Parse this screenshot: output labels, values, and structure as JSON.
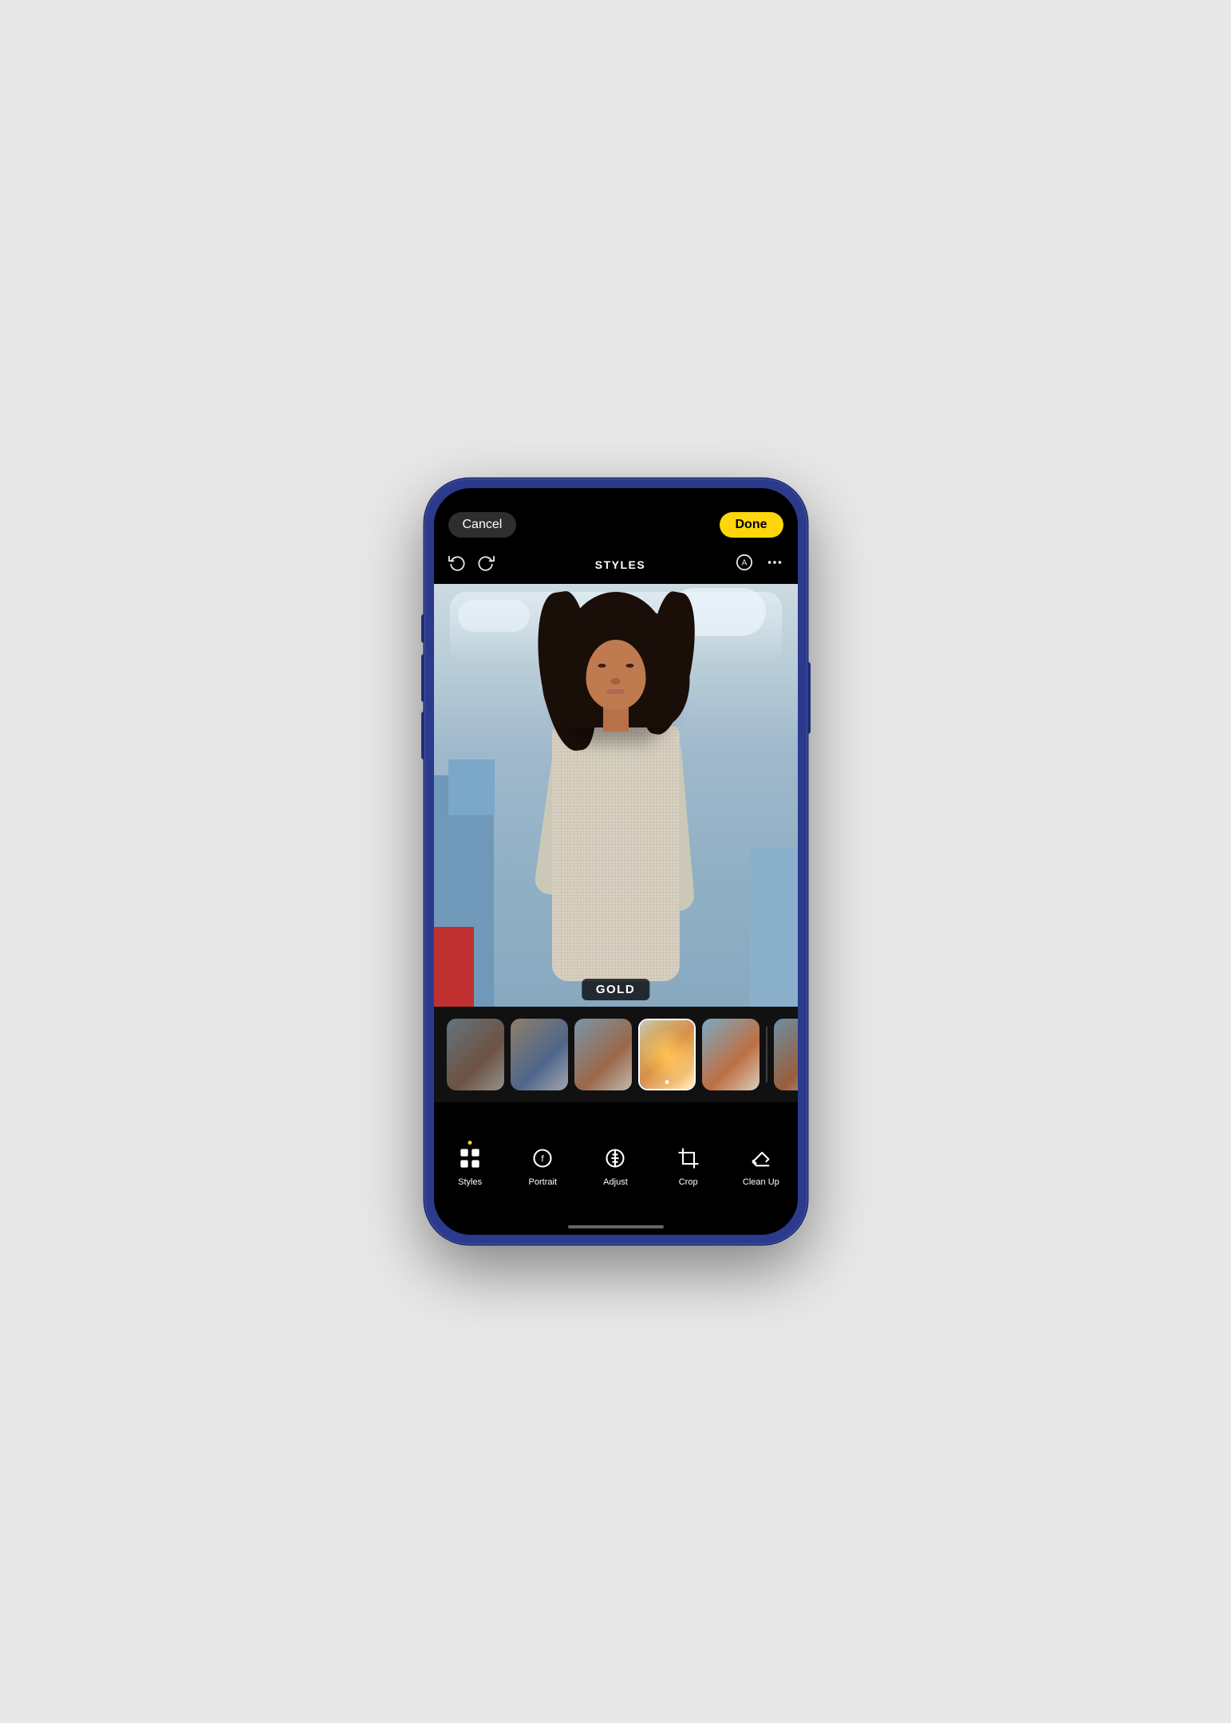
{
  "phone": {
    "topBar": {
      "cancelLabel": "Cancel",
      "doneLabel": "Done",
      "toolbarTitle": "STYLES"
    },
    "filterLabel": "GOLD",
    "filters": [
      {
        "id": 1,
        "name": "filter-1",
        "active": false
      },
      {
        "id": 2,
        "name": "filter-2",
        "active": false
      },
      {
        "id": 3,
        "name": "filter-3",
        "active": false
      },
      {
        "id": 4,
        "name": "filter-4-gold",
        "active": true
      },
      {
        "id": 5,
        "name": "filter-5",
        "active": false
      },
      {
        "id": 6,
        "name": "filter-6",
        "active": false
      }
    ],
    "bottomTools": [
      {
        "id": "styles",
        "label": "Styles",
        "icon": "grid",
        "active": true
      },
      {
        "id": "portrait",
        "label": "Portrait",
        "icon": "portrait",
        "active": false
      },
      {
        "id": "adjust",
        "label": "Adjust",
        "icon": "adjust",
        "active": false
      },
      {
        "id": "crop",
        "label": "Crop",
        "icon": "crop",
        "active": false
      },
      {
        "id": "cleanup",
        "label": "Clean Up",
        "icon": "eraser",
        "active": false
      }
    ]
  }
}
